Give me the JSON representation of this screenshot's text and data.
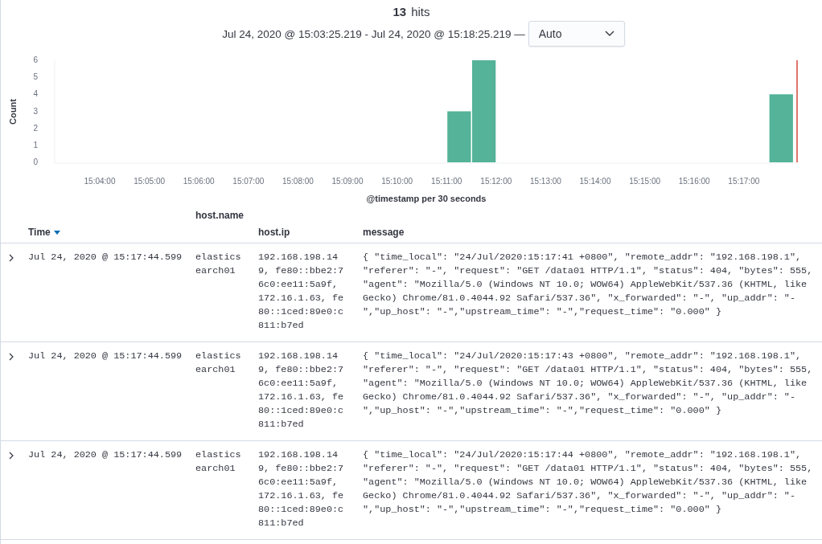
{
  "header": {
    "hits_count": "13",
    "hits_label": "hits",
    "time_range": "Jul 24, 2020 @ 15:03:25.219 - Jul 24, 2020 @ 15:18:25.219 —",
    "interval": {
      "value": "Auto"
    }
  },
  "chart": {
    "chart_data": {
      "type": "bar",
      "xlabel": "@timestamp per 30 seconds",
      "ylabel": "Count",
      "categories": [
        null,
        null,
        "15:04:00",
        null,
        "15:05:00",
        null,
        "15:06:00",
        null,
        "15:07:00",
        null,
        "15:08:00",
        null,
        "15:09:00",
        null,
        "15:10:00",
        null,
        "15:11:00",
        null,
        "15:12:00",
        null,
        "15:13:00",
        null,
        "15:14:00",
        null,
        "15:15:00",
        null,
        "15:16:00",
        null,
        "15:17:00",
        null
      ],
      "series": [
        {
          "color": "#54b399",
          "values": [
            0,
            0,
            0,
            0,
            0,
            0,
            0,
            0,
            0,
            0,
            0,
            0,
            0,
            0,
            0,
            0,
            3,
            6,
            0,
            0,
            0,
            0,
            0,
            0,
            0,
            0,
            0,
            0,
            0,
            4
          ]
        }
      ],
      "ylim": [
        0,
        6
      ],
      "yticks": [
        0,
        1,
        2,
        3,
        4,
        5,
        6
      ]
    }
  },
  "table": {
    "columns": [
      {
        "label": "Time",
        "sort_descending": true
      },
      {
        "label": "host.name"
      },
      {
        "label": "host.ip"
      },
      {
        "label": "message"
      }
    ],
    "rows": [
      {
        "expanded": false,
        "time": "Jul 24, 2020 @ 15:17:44.599",
        "host_name": "elasticsearch01",
        "host_ip": "192.168.198.149, fe80::bbe2:76c0:ee11:5a9f, 172.16.1.63, fe80::1ced:89e0:c811:b7ed",
        "message": "{ \"time_local\": \"24/Jul/2020:15:17:41 +0800\", \"remote_addr\": \"192.168.198.1\", \"referer\": \"-\", \"request\": \"GET /data01 HTTP/1.1\", \"status\": 404, \"bytes\": 555, \"agent\": \"Mozilla/5.0 (Windows NT 10.0; WOW64) AppleWebKit/537.36 (KHTML, like Gecko) Chrome/81.0.4044.92 Safari/537.36\", \"x_forwarded\": \"-\", \"up_addr\": \"-\",\"up_host\": \"-\",\"upstream_time\": \"-\",\"request_time\": \"0.000\" }"
      },
      {
        "expanded": false,
        "time": "Jul 24, 2020 @ 15:17:44.599",
        "host_name": "elasticsearch01",
        "host_ip": "192.168.198.149, fe80::bbe2:76c0:ee11:5a9f, 172.16.1.63, fe80::1ced:89e0:c811:b7ed",
        "message": "{ \"time_local\": \"24/Jul/2020:15:17:43 +0800\", \"remote_addr\": \"192.168.198.1\", \"referer\": \"-\", \"request\": \"GET /data01 HTTP/1.1\", \"status\": 404, \"bytes\": 555, \"agent\": \"Mozilla/5.0 (Windows NT 10.0; WOW64) AppleWebKit/537.36 (KHTML, like Gecko) Chrome/81.0.4044.92 Safari/537.36\", \"x_forwarded\": \"-\", \"up_addr\": \"-\",\"up_host\": \"-\",\"upstream_time\": \"-\",\"request_time\": \"0.000\" }"
      },
      {
        "expanded": false,
        "time": "Jul 24, 2020 @ 15:17:44.599",
        "host_name": "elasticsearch01",
        "host_ip": "192.168.198.149, fe80::bbe2:76c0:ee11:5a9f, 172.16.1.63, fe80::1ced:89e0:c811:b7ed",
        "message": "{ \"time_local\": \"24/Jul/2020:15:17:44 +0800\", \"remote_addr\": \"192.168.198.1\", \"referer\": \"-\", \"request\": \"GET /data01 HTTP/1.1\", \"status\": 404, \"bytes\": 555, \"agent\": \"Mozilla/5.0 (Windows NT 10.0; WOW64) AppleWebKit/537.36 (KHTML, like Gecko) Chrome/81.0.4044.92 Safari/537.36\", \"x_forwarded\": \"-\", \"up_addr\": \"-\",\"up_host\": \"-\",\"upstream_time\": \"-\",\"request_time\": \"0.000\" }"
      }
    ]
  }
}
